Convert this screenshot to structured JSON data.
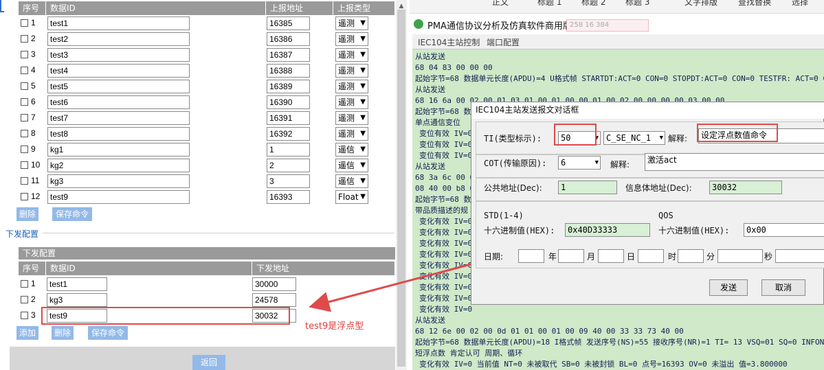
{
  "upload_table": {
    "headers": [
      "序号",
      "数据ID",
      "上报地址",
      "上报类型"
    ],
    "rows": [
      {
        "num": "1",
        "id": "test1",
        "addr": "16385",
        "type": "遥测"
      },
      {
        "num": "2",
        "id": "test2",
        "addr": "16386",
        "type": "遥测"
      },
      {
        "num": "3",
        "id": "test3",
        "addr": "16387",
        "type": "遥测"
      },
      {
        "num": "4",
        "id": "test4",
        "addr": "16388",
        "type": "遥测"
      },
      {
        "num": "5",
        "id": "test5",
        "addr": "16389",
        "type": "遥测"
      },
      {
        "num": "6",
        "id": "test6",
        "addr": "16390",
        "type": "遥测"
      },
      {
        "num": "7",
        "id": "test7",
        "addr": "16391",
        "type": "遥测"
      },
      {
        "num": "8",
        "id": "test8",
        "addr": "16392",
        "type": "遥测"
      },
      {
        "num": "9",
        "id": "kg1",
        "addr": "1",
        "type": "遥信"
      },
      {
        "num": "10",
        "id": "kg2",
        "addr": "2",
        "type": "遥信"
      },
      {
        "num": "11",
        "id": "kg3",
        "addr": "3",
        "type": "遥信"
      },
      {
        "num": "12",
        "id": "test9",
        "addr": "16393",
        "type": "Float"
      }
    ],
    "delete_label": "删除",
    "save_label": "保存命令"
  },
  "down_config": {
    "section_title": "下发配置",
    "panel_title": "下发配置",
    "headers": [
      "序号",
      "数据ID",
      "下发地址"
    ],
    "rows": [
      {
        "num": "1",
        "id": "test1",
        "addr": "30000"
      },
      {
        "num": "2",
        "id": "kg3",
        "addr": "24578"
      },
      {
        "num": "3",
        "id": "test9",
        "addr": "30032"
      }
    ],
    "add_label": "添加",
    "delete_label": "删除",
    "save_label": "保存命令"
  },
  "back_label": "返回",
  "annotation": "test9是浮点型",
  "word_toolbar": [
    "正文",
    "标题 1",
    "标题 2",
    "标题 3",
    "文字排版",
    "查找替换",
    "选择"
  ],
  "pma": {
    "title": "PMA通信协议分析及仿真软件商用版",
    "ghost_text": "258 16 384",
    "menu": [
      "IEC104主站控制",
      "端口配置"
    ],
    "log_lines": [
      {
        "text": "从站发送",
        "indent": false
      },
      {
        "text": "68 04 83 00 00 00",
        "indent": false
      },
      {
        "text": "起始字节=68 数据单元长度(APDU)=4 U格式帧 STARTDT:ACT=0 CON=0 STOPDT:ACT=0 CON=0 TESTFR: ACT=0 CON=1",
        "indent": false
      },
      {
        "text": "从站发送",
        "indent": false
      },
      {
        "text": "68 16 6a 00 02 00 01 03 01 00 01 00 00 01 00 02 00 00 00 00 03 00 00",
        "indent": false
      },
      {
        "text": "起始字节=68 数",
        "indent": false
      },
      {
        "text": "单点通信变位",
        "indent": false
      },
      {
        "text": "变位有效 IV=0",
        "indent": true
      },
      {
        "text": "变位有效 IV=0",
        "indent": true
      },
      {
        "text": "变位有效 IV=0",
        "indent": true
      },
      {
        "text": "从站发送",
        "indent": false
      },
      {
        "text": "68 3a 6c 00 0",
        "indent": false
      },
      {
        "text": "08 40 00 b8 0",
        "indent": false
      },
      {
        "text": "起始字节=68 数",
        "indent": false
      },
      {
        "text": "带品质描述的规",
        "indent": false
      },
      {
        "text": "变化有效 IV=0",
        "indent": true
      },
      {
        "text": "变化有效 IV=0",
        "indent": true
      },
      {
        "text": "变化有效 IV=0",
        "indent": true
      },
      {
        "text": "变化有效 IV=0",
        "indent": true
      },
      {
        "text": "变化有效 IV=0",
        "indent": true
      },
      {
        "text": "变化有效 IV=0",
        "indent": true
      },
      {
        "text": "变化有效 IV=0",
        "indent": true
      },
      {
        "text": "变化有效 IV=0",
        "indent": true
      },
      {
        "text": "变化有效 IV=0",
        "indent": true
      },
      {
        "text": "从站发送",
        "indent": false
      },
      {
        "text": "68 12 6e 00 02 00 0d 01 01 00 01 00 09 40 00 33 33 73 40 00",
        "indent": false
      },
      {
        "text": "起始字节=68 数据单元长度(APDU)=18 I格式帧 发送序号(NS)=55 接收序号(NR)=1 TI= 13 VSQ=01 SQ=0 INFONUM",
        "indent": false
      },
      {
        "text": "短浮点数        肯定认可      周期、循环",
        "indent": false
      },
      {
        "text": "变化有效 IV=0  当前值 NT=0  未被取代 SB=0  未被封锁 BL=0 点号=16393 OV=0 未溢出  值=3.800000",
        "indent": true
      }
    ]
  },
  "dialog": {
    "title": "IEC104主站发送报文对话框",
    "ti_label": "TI(类型标示):",
    "ti_value": "50",
    "ti_name": "C_SE_NC_1",
    "ti_explain_label": "解释:",
    "ti_explain": "设定浮点数值命令",
    "cot_label": "COT(传输原因):",
    "cot_value": "6",
    "cot_explain_label": "解释:",
    "cot_explain": "激活act",
    "common_addr_label": "公共地址(Dec):",
    "common_addr": "1",
    "info_addr_label": "信息体地址(Dec):",
    "info_addr": "30032",
    "std_label": "STD(1-4)",
    "qos_label": "QOS",
    "hex_label": "十六进制值(HEX):",
    "std_hex": "0x40D33333",
    "qos_hex_label": "十六进制值(HEX):",
    "qos_hex": "0x00",
    "date_label": "日期:",
    "year_label": "年",
    "month_label": "月",
    "day_label": "日",
    "hour_label": "时",
    "minute_label": "分",
    "second_label": "秒",
    "send_label": "发送",
    "cancel_label": "取消"
  },
  "colors": {
    "header_gray": "#9a9a9a",
    "button_blue": "#93b9e8",
    "highlight_red": "#e04a4a",
    "log_green": "#cfe9c9"
  }
}
